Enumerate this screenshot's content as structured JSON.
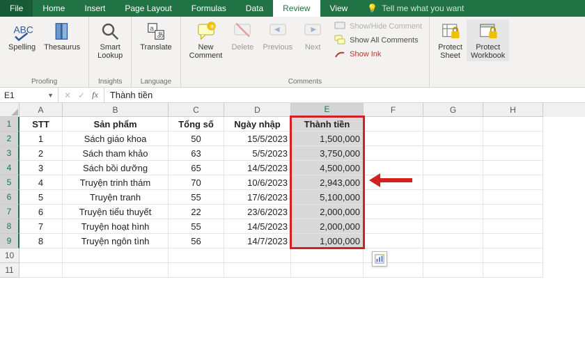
{
  "menubar": {
    "file": "File",
    "tabs": [
      "Home",
      "Insert",
      "Page Layout",
      "Formulas",
      "Data",
      "Review",
      "View"
    ],
    "active_tab": "Review",
    "tell_me": "Tell me what you want"
  },
  "ribbon": {
    "spelling": "Spelling",
    "thesaurus": "Thesaurus",
    "proofing_group": "Proofing",
    "smart_lookup": "Smart\nLookup",
    "insights_group": "Insights",
    "translate": "Translate",
    "language_group": "Language",
    "new_comment": "New\nComment",
    "delete": "Delete",
    "previous": "Previous",
    "next": "Next",
    "show_hide_comment": "Show/Hide Comment",
    "show_all_comments": "Show All Comments",
    "show_ink": "Show Ink",
    "comments_group": "Comments",
    "protect_sheet": "Protect\nSheet",
    "protect_workbook": "Protect\nWorkbook"
  },
  "namebox": {
    "value": "E1"
  },
  "formula": {
    "value": "Thành tiền"
  },
  "grid": {
    "cols": [
      "A",
      "B",
      "C",
      "D",
      "E",
      "F",
      "G",
      "H"
    ],
    "selected_col": "E",
    "selected_rows": [
      1,
      2,
      3,
      4,
      5,
      6,
      7,
      8,
      9
    ],
    "header": {
      "A": "STT",
      "B": "Sản phẩm",
      "C": "Tổng số",
      "D": "Ngày nhập",
      "E": "Thành tiền"
    },
    "rows": [
      {
        "A": "1",
        "B": "Sách giáo khoa",
        "C": "50",
        "D": "15/5/2023",
        "E": "1,500,000"
      },
      {
        "A": "2",
        "B": "Sách tham khảo",
        "C": "63",
        "D": "5/5/2023",
        "E": "3,750,000"
      },
      {
        "A": "3",
        "B": "Sách bồi dưỡng",
        "C": "65",
        "D": "14/5/2023",
        "E": "4,500,000"
      },
      {
        "A": "4",
        "B": "Truyện trinh thám",
        "C": "70",
        "D": "10/6/2023",
        "E": "2,943,000"
      },
      {
        "A": "5",
        "B": "Truyện tranh",
        "C": "55",
        "D": "17/6/2023",
        "E": "5,100,000"
      },
      {
        "A": "6",
        "B": "Truyện tiểu thuyết",
        "C": "22",
        "D": "23/6/2023",
        "E": "2,000,000"
      },
      {
        "A": "7",
        "B": "Truyện hoạt hình",
        "C": "55",
        "D": "14/5/2023",
        "E": "2,000,000"
      },
      {
        "A": "8",
        "B": "Truyện ngôn tình",
        "C": "56",
        "D": "14/7/2023",
        "E": "1,000,000"
      }
    ]
  }
}
